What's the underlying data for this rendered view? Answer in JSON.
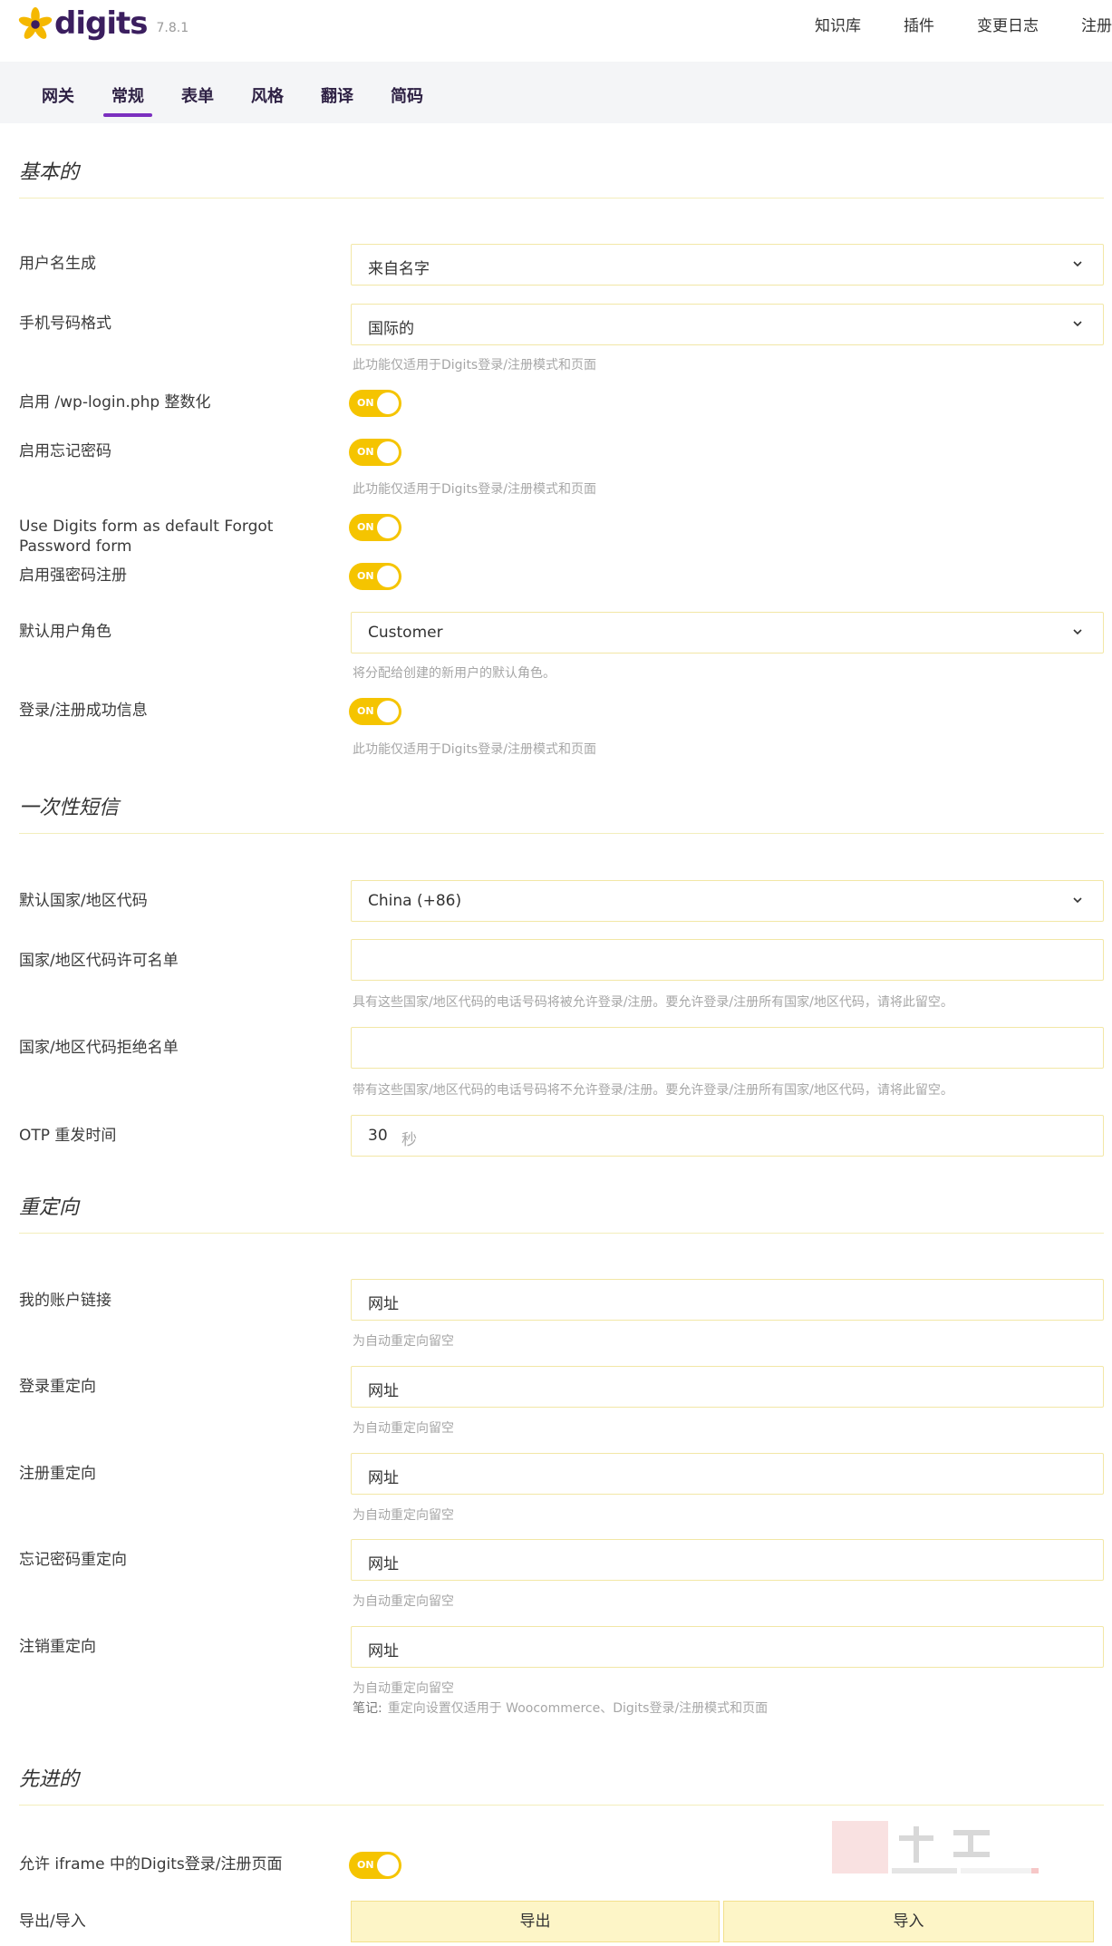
{
  "header": {
    "logo": "digits",
    "version": "7.8.1",
    "nav": [
      "知识库",
      "插件",
      "变更日志",
      "注册"
    ]
  },
  "tabs": [
    "网关",
    "常规",
    "表单",
    "风格",
    "翻译",
    "简码"
  ],
  "active_tab": "常规",
  "sections": {
    "basic": "基本的",
    "otp": "一次性短信",
    "redirect": "重定向",
    "advanced": "先进的"
  },
  "basic": {
    "username_label": "用户名生成",
    "username_value": "来自名字",
    "phone_format_label": "手机号码格式",
    "phone_format_value": "国际的",
    "digits_only_hint": "此功能仅适用于Digits登录/注册模式和页面",
    "wplogin_label": "启用 /wp-login.php 整数化",
    "forgot_label": "启用忘记密码",
    "use_digits_forgot_label": "Use Digits form as default Forgot Password form",
    "strong_pw_label": "启用强密码注册",
    "default_role_label": "默认用户角色",
    "default_role_value": "Customer",
    "default_role_hint": "将分配给创建的新用户的默认角色。",
    "success_msg_label": "登录/注册成功信息",
    "toggle_on": "ON"
  },
  "otp": {
    "country_code_label": "默认国家/地区代码",
    "country_code_value": "China (+86)",
    "whitelist_label": "国家/地区代码许可名单",
    "whitelist_value": "",
    "whitelist_hint": "具有这些国家/地区代码的电话号码将被允许登录/注册。要允许登录/注册所有国家/地区代码，请将此留空。",
    "blacklist_label": "国家/地区代码拒绝名单",
    "blacklist_value": "",
    "blacklist_hint": "带有这些国家/地区代码的电话号码将不允许登录/注册。要允许登录/注册所有国家/地区代码，请将此留空。",
    "resend_label": "OTP 重发时间",
    "resend_value": "30",
    "resend_unit": "秒"
  },
  "redirect": {
    "url_placeholder": "网址",
    "auto_hint": "为自动重定向留空",
    "account_label": "我的账户链接",
    "login_label": "登录重定向",
    "register_label": "注册重定向",
    "forgot_label": "忘记密码重定向",
    "logout_label": "注销重定向",
    "note_prefix": "笔记:",
    "note_text": "重定向设置仅适用于 Woocommerce、Digits登录/注册模式和页面"
  },
  "advanced": {
    "iframe_label": "允许 iframe 中的Digits登录/注册页面",
    "export_import_label": "导出/导入",
    "export_button": "导出",
    "import_button": "导入"
  },
  "colors": {
    "accent_purple": "#7b2fbf",
    "toggle_yellow": "#f5c400",
    "logo_star": "#f5b800",
    "field_border": "#f2e7a6"
  }
}
